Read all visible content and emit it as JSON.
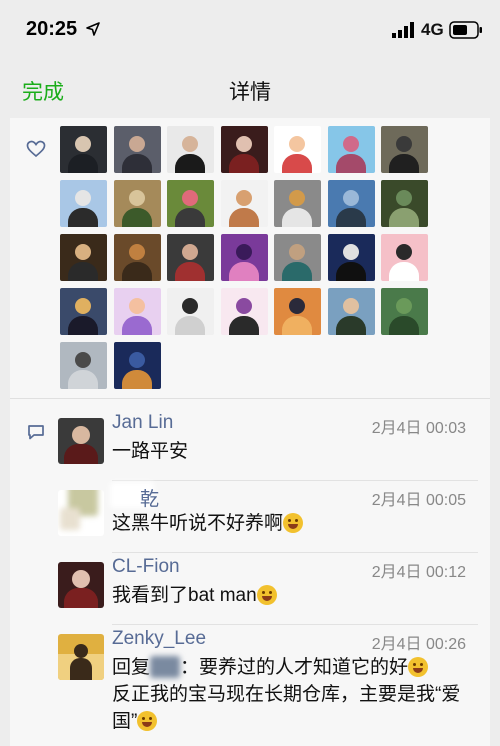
{
  "status_bar": {
    "time": "20:25",
    "network": "4G",
    "icons": [
      "location-arrow-icon",
      "signal-bars-icon",
      "battery-icon"
    ]
  },
  "nav": {
    "back_label": "完成",
    "title": "详情"
  },
  "likes": {
    "icon": "heart-icon",
    "avatars": [
      {
        "colors": [
          "#2b2e33",
          "#d8c5b0",
          "#1c1f24"
        ]
      },
      {
        "colors": [
          "#5b5e6a",
          "#c9a893",
          "#2e2f38"
        ]
      },
      {
        "colors": [
          "#e9e9e9",
          "#d6b49a",
          "#1a1a1a"
        ]
      },
      {
        "colors": [
          "#3a1c1c",
          "#e0c0b0",
          "#7a2020"
        ]
      },
      {
        "colors": [
          "#ffffff",
          "#f4c6a0",
          "#d84a4a"
        ]
      },
      {
        "colors": [
          "#86c6e8",
          "#d06a8a",
          "#a44a6a"
        ]
      },
      {
        "colors": [
          "#6e6a5a",
          "#3a3a3a",
          "#202020"
        ]
      },
      {
        "colors": [
          "#a9c7e6",
          "#e5e5e5",
          "#2b2b2b"
        ]
      },
      {
        "colors": [
          "#a58a5a",
          "#d8c49a",
          "#3c5a2a"
        ]
      },
      {
        "colors": [
          "#6a8a3a",
          "#e06a7a",
          "#3a3a3a"
        ]
      },
      {
        "colors": [
          "#f2f2f2",
          "#d8a070",
          "#c07a4a"
        ]
      },
      {
        "colors": [
          "#8a8a8a",
          "#d29a4a",
          "#e5e5e5"
        ]
      },
      {
        "colors": [
          "#4a7ab0",
          "#9ab8d8",
          "#2a3a4a"
        ]
      },
      {
        "colors": [
          "#3a4a2a",
          "#6a8a5a",
          "#8aa070"
        ]
      },
      {
        "colors": [
          "#3a2a1a",
          "#d8b080",
          "#2a2a2a"
        ]
      },
      {
        "colors": [
          "#6a4a2a",
          "#c08040",
          "#3a2a1a"
        ]
      },
      {
        "colors": [
          "#3a3a3a",
          "#d0a890",
          "#a03030"
        ]
      },
      {
        "colors": [
          "#7a3a9a",
          "#3a1a5a",
          "#e080c0"
        ]
      },
      {
        "colors": [
          "#8a8a8a",
          "#c0a080",
          "#2a6a6a"
        ]
      },
      {
        "colors": [
          "#1a2a5a",
          "#e0e0e0",
          "#101010"
        ]
      },
      {
        "colors": [
          "#f5c0c8",
          "#2a2a2a",
          "#ffffff"
        ]
      },
      {
        "colors": [
          "#3a4a6a",
          "#e0b060",
          "#1a1a2a"
        ]
      },
      {
        "colors": [
          "#e8d0f0",
          "#f4c0a0",
          "#9a6ad0"
        ]
      },
      {
        "colors": [
          "#f0f0f0",
          "#2a2a2a",
          "#d0d0d0"
        ]
      },
      {
        "colors": [
          "#f8e8f0",
          "#8a4aa0",
          "#2a2a2a"
        ]
      },
      {
        "colors": [
          "#e08a40",
          "#2a2a3a",
          "#f0b060"
        ]
      },
      {
        "colors": [
          "#7aa0c0",
          "#e0c0a0",
          "#2a3a2a"
        ]
      },
      {
        "colors": [
          "#4a7a4a",
          "#6a9a5a",
          "#2a4a2a"
        ]
      },
      {
        "colors": [
          "#b0b8c0",
          "#4a4a4a",
          "#d0d4d8"
        ]
      },
      {
        "colors": [
          "#1a2a5a",
          "#3a5aa0",
          "#d08a3a"
        ]
      }
    ]
  },
  "comments": {
    "icon": "comment-bubble-icon",
    "items": [
      {
        "name": "Jan Lin",
        "time": "2月4日 00:03",
        "text": "一路平安",
        "avatar_colors": [
          "#3a3a3a",
          "#d8b8a0",
          "#5a1a1a"
        ]
      },
      {
        "name": "乾",
        "time": "2月4日 00:05",
        "text": "这黑牛听说不好养啊",
        "avatar_colors": [
          "#e8e0d0",
          "#c8c8a0",
          "#a0a080"
        ]
      },
      {
        "name": "CL-Fion",
        "time": "2月4日 00:12",
        "text": "我看到了bat man",
        "avatar_colors": [
          "#3a1c1c",
          "#e0c0b0",
          "#7a2020"
        ]
      },
      {
        "name": "Zenky_Lee",
        "time": "2月4日 00:26",
        "reply_prefix": "回复",
        "text_a": "：要养过的人才知道它的好",
        "text_b": "反正我的宝马现在长期仓库，主要是我“爱国”",
        "avatar_colors": [
          "#e0b040",
          "#3a2a1a",
          "#f0d080"
        ]
      }
    ]
  }
}
